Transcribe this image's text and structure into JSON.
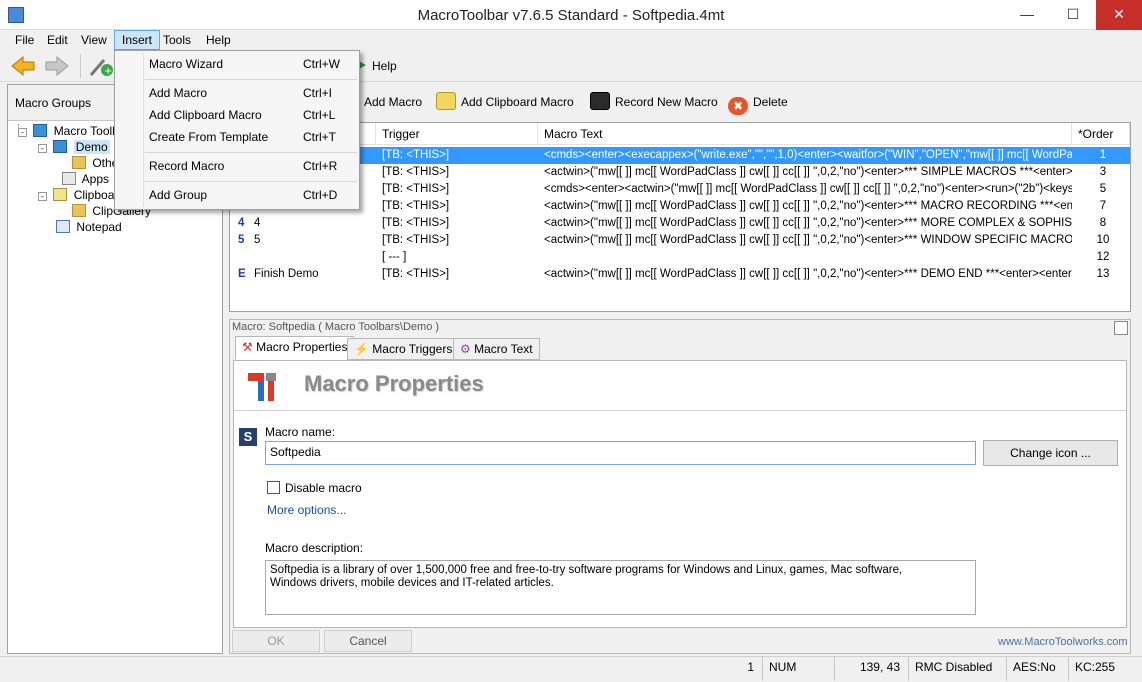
{
  "window": {
    "title": "MacroToolbar v7.6.5 Standard - Softpedia.4mt"
  },
  "menubar": {
    "items": [
      "File",
      "Edit",
      "View",
      "Insert",
      "Tools",
      "Help"
    ]
  },
  "toolbar": {
    "help_label": "Help"
  },
  "left_pane": {
    "header": "Macro Groups",
    "tree": [
      {
        "label": "Macro Toolb"
      },
      {
        "label": "Demo"
      },
      {
        "label": "Othe"
      },
      {
        "label": "Apps"
      },
      {
        "label": "Clipboar"
      },
      {
        "label": "ClipGallery"
      },
      {
        "label": "Notepad"
      }
    ]
  },
  "right_toolbar": {
    "add_macro": "Add Macro",
    "add_clipboard_macro": "Add Clipboard Macro",
    "record_new_macro": "Record New Macro",
    "delete": "Delete"
  },
  "table": {
    "columns": {
      "trigger": "Trigger",
      "text": "Macro Text",
      "order": "*Order"
    },
    "rows": [
      {
        "name": "",
        "trigger": "[TB: <THIS>]",
        "text": "<cmds><enter><execappex>(\"write.exe\",\"\",\"\",1,0)<enter><waitfor>(\"WIN\",\"OPEN\",\"mw[[ ]] mc[[ WordPad...",
        "order": "1",
        "selected": true
      },
      {
        "name": "",
        "trigger": "[TB: <THIS>]",
        "text": "<actwin>(\"mw[[  ]] mc[[ WordPadClass ]] cw[[  ]] cc[[  ]] \",0,2,\"no\")<enter>*** SIMPLE MACROS ***<enter><...",
        "order": "3"
      },
      {
        "name": "",
        "trigger": "[TB: <THIS>]",
        "text": "<cmds><enter><actwin>(\"mw[[  ]] mc[[ WordPadClass ]] cw[[  ]] cc[[  ]] \",0,2,\"no\")<enter><run>(\"2b\")<keys>...",
        "order": "5"
      },
      {
        "name": "",
        "trigger": "[TB: <THIS>]",
        "text": "<actwin>(\"mw[[  ]] mc[[ WordPadClass ]] cw[[  ]] cc[[  ]] \",0,2,\"no\")<enter>*** MACRO RECORDING ***<ent...",
        "order": "7"
      },
      {
        "name": "4",
        "trigger": "[TB: <THIS>]",
        "text": "<actwin>(\"mw[[  ]] mc[[ WordPadClass ]] cw[[  ]] cc[[  ]] \",0,2,\"no\")<enter>*** MORE COMPLEX & SOPHISTI...",
        "order": "8"
      },
      {
        "name": "5",
        "trigger": "[TB: <THIS>]",
        "text": "<actwin>(\"mw[[  ]] mc[[ WordPadClass ]] cw[[  ]] cc[[  ]] \",0,2,\"no\")<enter>*** WINDOW SPECIFIC MACRO ...",
        "order": "10"
      },
      {
        "name": "",
        "trigger": "[ --- ]",
        "text": "",
        "order": "12"
      },
      {
        "name": "Finish Demo",
        "trigger": "[TB: <THIS>]",
        "text": "<actwin>(\"mw[[  ]] mc[[ WordPadClass ]] cw[[  ]] cc[[  ]] \",0,2,\"no\")<enter>*** DEMO END ***<enter><enter>...",
        "order": "13"
      }
    ],
    "row_badges": [
      "",
      "",
      "",
      "",
      "4",
      "5",
      "",
      "E"
    ]
  },
  "macro_panel": {
    "caption": "Macro: Softpedia ( Macro Toolbars\\Demo )",
    "tabs": [
      "Macro Properties",
      "Macro Triggers",
      "Macro Text"
    ],
    "heading": "Macro Properties",
    "macro_name_label": "Macro name:",
    "macro_name_value": "Softpedia",
    "change_icon": "Change icon ...",
    "disable_macro": "Disable macro",
    "more_options": "More options...",
    "description_label": "Macro description:",
    "description_line1": "Softpedia is a library of over 1,500,000 free and free-to-try software programs for Windows and Linux, games, Mac software,",
    "description_line2": "Windows drivers, mobile devices and IT-related articles.",
    "ok": "OK",
    "cancel": "Cancel",
    "website": "www.MacroToolworks.com"
  },
  "insert_menu": {
    "items": [
      {
        "label": "Macro Wizard",
        "shortcut": "Ctrl+W"
      },
      {
        "label": "Add Macro",
        "shortcut": "Ctrl+I"
      },
      {
        "label": "Add Clipboard Macro",
        "shortcut": "Ctrl+L"
      },
      {
        "label": "Create From Template",
        "shortcut": "Ctrl+T"
      },
      {
        "label": "Record Macro",
        "shortcut": "Ctrl+R"
      },
      {
        "label": "Add Group",
        "shortcut": "Ctrl+D"
      }
    ]
  },
  "statusbar": {
    "page": "1",
    "num": "NUM",
    "coords": "139,  43",
    "rmc": "RMC Disabled",
    "aes": "AES:No",
    "kc": "KC:255"
  },
  "colors": {
    "selection": "#3399ff",
    "menu_highlight": "#cde6f7",
    "close_button": "#c7302a",
    "link": "#1a4fa8"
  }
}
